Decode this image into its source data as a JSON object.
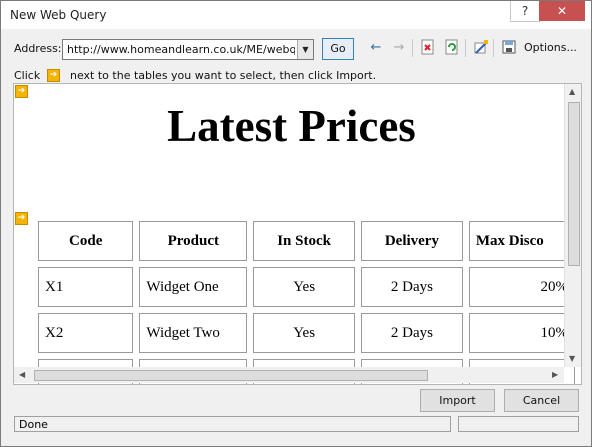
{
  "window": {
    "title": "New Web Query"
  },
  "titlebar": {
    "help": "?",
    "close": "✕"
  },
  "address": {
    "label": "Address:",
    "value": "http://www.homeandlearn.co.uk/ME/webquery",
    "go": "Go"
  },
  "toolbar": {
    "options": "Options..."
  },
  "instruction": {
    "click": "Click",
    "rest": "next to the tables you want to select, then click Import."
  },
  "page": {
    "heading": "Latest Prices",
    "table": {
      "headers": [
        "Code",
        "Product",
        "In Stock",
        "Delivery",
        "Max Disco"
      ],
      "rows": [
        [
          "X1",
          "Widget One",
          "Yes",
          "2 Days",
          "20%"
        ],
        [
          "X2",
          "Widget Two",
          "Yes",
          "2 Days",
          "10%"
        ]
      ]
    }
  },
  "buttons": {
    "import": "Import",
    "cancel": "Cancel"
  },
  "status": {
    "text": "Done"
  }
}
